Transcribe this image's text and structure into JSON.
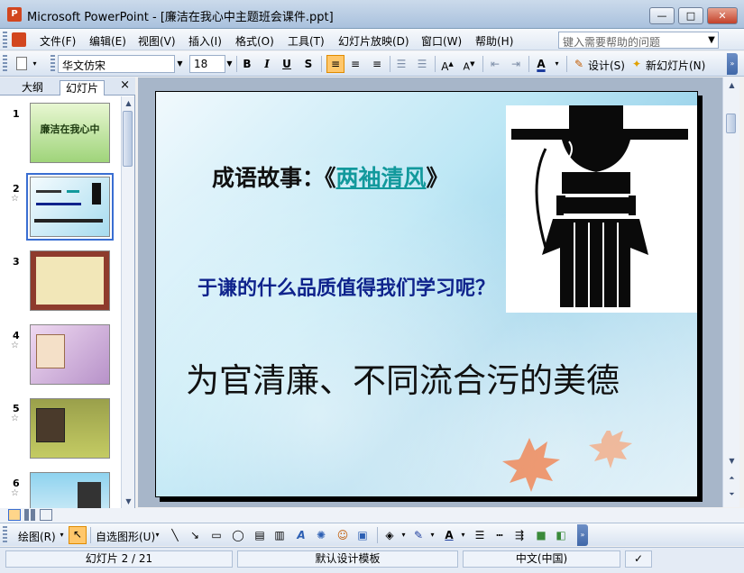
{
  "window": {
    "app_icon": "powerpoint-icon",
    "title": "Microsoft PowerPoint - [廉洁在我心中主题班会课件.ppt]",
    "buttons": {
      "minimize": "—",
      "maximize": "□",
      "close": "✕"
    }
  },
  "menu": {
    "items": [
      "文件(F)",
      "编辑(E)",
      "视图(V)",
      "插入(I)",
      "格式(O)",
      "工具(T)",
      "幻灯片放映(D)",
      "窗口(W)",
      "帮助(H)"
    ],
    "help_placeholder": "键入需要帮助的问题"
  },
  "toolbar": {
    "font_name": "华文仿宋",
    "font_size": "18",
    "bold": "B",
    "italic": "I",
    "underline": "U",
    "shadow": "S",
    "design_label": "设计(S)",
    "new_slide_label": "新幻灯片(N)"
  },
  "left_pane": {
    "tab_outline": "大纲",
    "tab_slides": "幻灯片",
    "close": "×",
    "thumbnails": [
      {
        "number": "1",
        "text": "廉洁在我心中",
        "star": ""
      },
      {
        "number": "2",
        "text": "",
        "star": "☆"
      },
      {
        "number": "3",
        "text": "",
        "star": ""
      },
      {
        "number": "4",
        "text": "",
        "star": "☆"
      },
      {
        "number": "5",
        "text": "",
        "star": "☆"
      },
      {
        "number": "6",
        "text": "",
        "star": "☆"
      }
    ]
  },
  "slide": {
    "title_prefix": "成语故事：《",
    "title_link": "两袖清风",
    "title_suffix": "》",
    "question": "于谦的什么品质值得我们学习呢？",
    "answer": "为官清廉、不同流合污的美德"
  },
  "drawing": {
    "draw_label": "绘图(R)",
    "autoshapes_label": "自选图形(U)"
  },
  "status": {
    "slide_pos": "幻灯片 2 / 21",
    "template": "默认设计模板",
    "language": "中文(中国)"
  }
}
